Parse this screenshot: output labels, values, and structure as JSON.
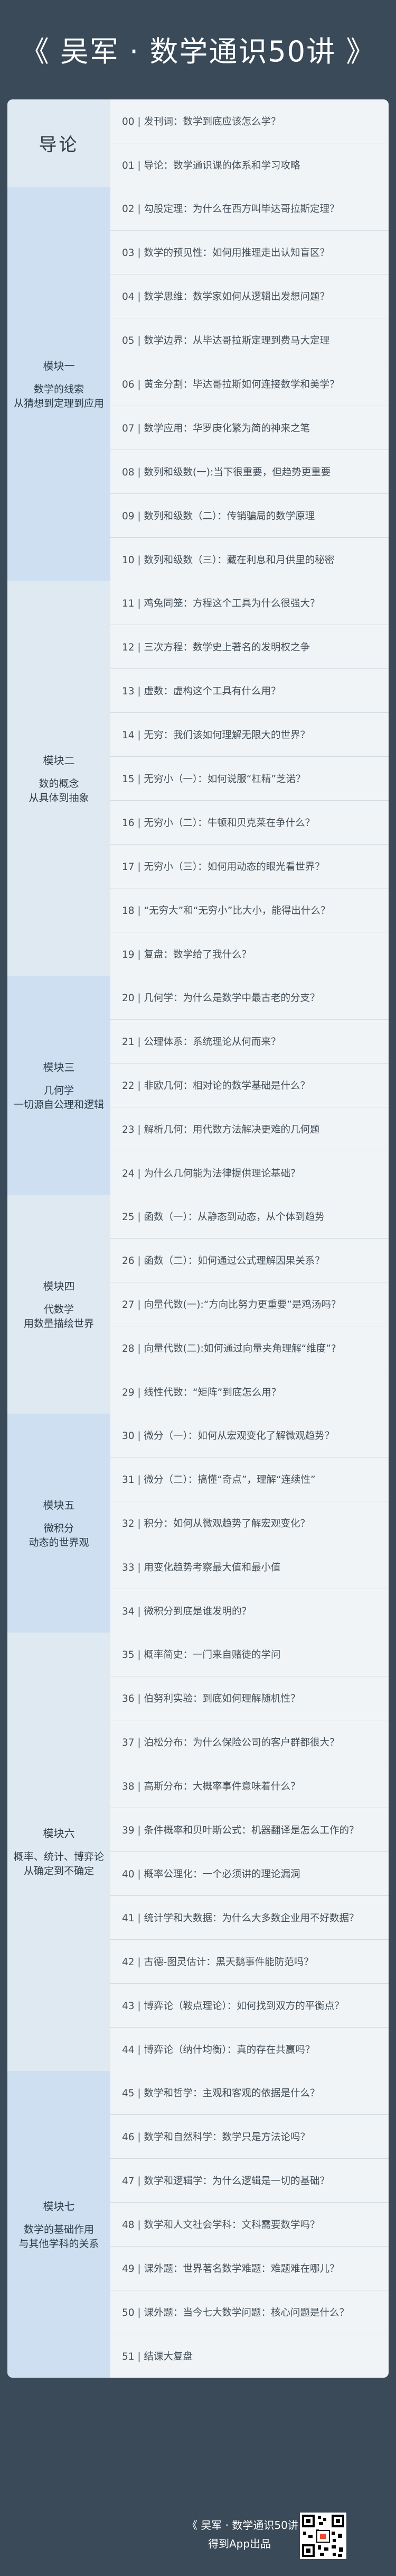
{
  "header": {
    "title": "《 吴军 · 数学通识50讲 》"
  },
  "sections": [
    {
      "title": "导论",
      "subtitle": "",
      "lessons": [
        "00 | 发刊词：数学到底应该怎么学？",
        "01 | 导论：数学通识课的体系和学习攻略"
      ]
    },
    {
      "title": "模块一",
      "subtitle": "数学的线索\n从猜想到定理到应用",
      "lessons": [
        "02 | 勾股定理：为什么在西方叫毕达哥拉斯定理？",
        "03 | 数学的预见性：如何用推理走出认知盲区？",
        "04 | 数学思维：数学家如何从逻辑出发想问题？",
        "05 | 数学边界：从毕达哥拉斯定理到费马大定理",
        "06 | 黄金分割：毕达哥拉斯如何连接数学和美学？",
        "07 | 数学应用：华罗庚化繁为简的神来之笔",
        "08 | 数列和级数(一):当下很重要，但趋势更重要",
        "09 | 数列和级数（二）：传销骗局的数学原理",
        "10 | 数列和级数（三）：藏在利息和月供里的秘密"
      ]
    },
    {
      "title": "模块二",
      "subtitle": "数的概念\n从具体到抽象",
      "lessons": [
        "11 | 鸡兔同笼：方程这个工具为什么很强大？",
        "12 | 三次方程：数学史上著名的发明权之争",
        "13 | 虚数：虚构这个工具有什么用？",
        "14 | 无穷：我们该如何理解无限大的世界？",
        "15 | 无穷小（一）：如何说服“杠精”芝诺？",
        "16 | 无穷小（二）：牛顿和贝克莱在争什么？",
        "17 | 无穷小（三）：如何用动态的眼光看世界？",
        "18 | “无穷大”和“无穷小”比大小，能得出什么？",
        "19 | 复盘：数学给了我什么？"
      ]
    },
    {
      "title": "模块三",
      "subtitle": "几何学\n一切源自公理和逻辑",
      "lessons": [
        "20 | 几何学：为什么是数学中最古老的分支？",
        "21 | 公理体系：系统理论从何而来？",
        "22 | 非欧几何：相对论的数学基础是什么？",
        "23 | 解析几何：用代数方法解决更难的几何题",
        "24 | 为什么几何能为法律提供理论基础？"
      ]
    },
    {
      "title": "模块四",
      "subtitle": "代数学\n用数量描绘世界",
      "lessons": [
        "25 | 函数（一）：从静态到动态，从个体到趋势",
        "26 | 函数（二）：如何通过公式理解因果关系？",
        "27 | 向量代数(一):“方向比努力更重要”是鸡汤吗？",
        "28 | 向量代数(二):如何通过向量夹角理解“维度”?",
        "29 | 线性代数：“矩阵”到底怎么用？"
      ]
    },
    {
      "title": "模块五",
      "subtitle": "微积分\n动态的世界观",
      "lessons": [
        "30 | 微分（一）：如何从宏观变化了解微观趋势？",
        "31 | 微分（二）：搞懂“奇点”，理解“连续性”",
        "32 | 积分：如何从微观趋势了解宏观变化？",
        "33 | 用变化趋势考察最大值和最小值",
        "34 | 微积分到底是谁发明的？"
      ]
    },
    {
      "title": "模块六",
      "subtitle": "概率、统计、博弈论\n从确定到不确定",
      "lessons": [
        "35 | 概率简史：一门来自赌徒的学问",
        "36 | 伯努利实验：到底如何理解随机性？",
        "37 | 泊松分布：为什么保险公司的客户群都很大？",
        "38 | 高斯分布：大概率事件意味着什么？",
        "39 | 条件概率和贝叶斯公式：机器翻译是怎么工作的？",
        "40 | 概率公理化：一个必须讲的理论漏洞",
        "41 | 统计学和大数据：为什么大多数企业用不好数据？",
        "42 | 古德-图灵估计：黑天鹅事件能防范吗？",
        "43 | 博弈论（鞍点理论）：如何找到双方的平衡点？",
        "44 | 博弈论（纳什均衡）：真的存在共赢吗？"
      ]
    },
    {
      "title": "模块七",
      "subtitle": "数学的基础作用\n与其他学科的关系",
      "lessons": [
        "45 | 数学和哲学：主观和客观的依据是什么？",
        "46 | 数学和自然科学：数学只是方法论吗？",
        "47 | 数学和逻辑学：为什么逻辑是一切的基础？",
        "48 | 数学和人文社会学科：文科需要数学吗？",
        "49 | 课外题：世界著名数学难题：难题难在哪儿？",
        "50 | 课外题：当今七大数学问题：核心问题是什么？",
        "51 | 结课大复盘"
      ]
    }
  ],
  "footer": {
    "course": "《 吴军 · 数学通识50讲 》",
    "publisher": "得到App出品"
  }
}
